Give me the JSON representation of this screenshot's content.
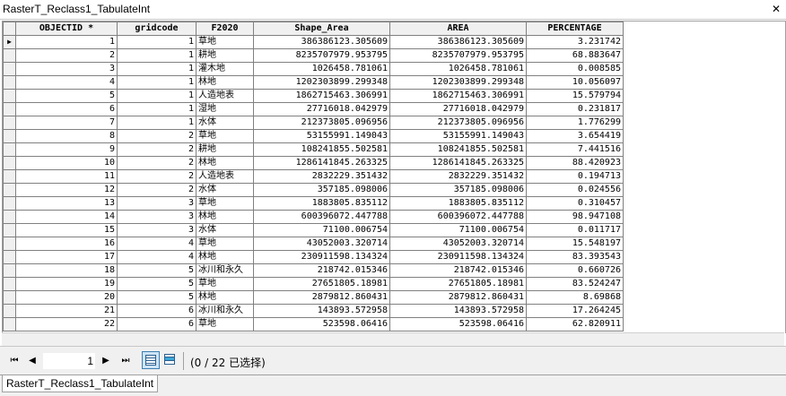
{
  "window": {
    "title": "RasterT_Reclass1_TabulateInt",
    "close_glyph": "✕"
  },
  "table": {
    "columns": [
      "OBJECTID *",
      "gridcode",
      "F2020",
      "Shape_Area",
      "AREA",
      "PERCENTAGE"
    ],
    "current_row_marker": "▶",
    "rows": [
      [
        "1",
        "1",
        "草地",
        "386386123.305609",
        "386386123.305609",
        "3.231742"
      ],
      [
        "2",
        "1",
        "耕地",
        "8235707979.953795",
        "8235707979.953795",
        "68.883647"
      ],
      [
        "3",
        "1",
        "灌木地",
        "1026458.781061",
        "1026458.781061",
        "0.008585"
      ],
      [
        "4",
        "1",
        "林地",
        "1202303899.299348",
        "1202303899.299348",
        "10.056097"
      ],
      [
        "5",
        "1",
        "人造地表",
        "1862715463.306991",
        "1862715463.306991",
        "15.579794"
      ],
      [
        "6",
        "1",
        "湿地",
        "27716018.042979",
        "27716018.042979",
        "0.231817"
      ],
      [
        "7",
        "1",
        "水体",
        "212373805.096956",
        "212373805.096956",
        "1.776299"
      ],
      [
        "8",
        "2",
        "草地",
        "53155991.149043",
        "53155991.149043",
        "3.654419"
      ],
      [
        "9",
        "2",
        "耕地",
        "108241855.502581",
        "108241855.502581",
        "7.441516"
      ],
      [
        "10",
        "2",
        "林地",
        "1286141845.263325",
        "1286141845.263325",
        "88.420923"
      ],
      [
        "11",
        "2",
        "人造地表",
        "2832229.351432",
        "2832229.351432",
        "0.194713"
      ],
      [
        "12",
        "2",
        "水体",
        "357185.098006",
        "357185.098006",
        "0.024556"
      ],
      [
        "13",
        "3",
        "草地",
        "1883805.835112",
        "1883805.835112",
        "0.310457"
      ],
      [
        "14",
        "3",
        "林地",
        "600396072.447788",
        "600396072.447788",
        "98.947108"
      ],
      [
        "15",
        "3",
        "水体",
        "71100.006754",
        "71100.006754",
        "0.011717"
      ],
      [
        "16",
        "4",
        "草地",
        "43052003.320714",
        "43052003.320714",
        "15.548197"
      ],
      [
        "17",
        "4",
        "林地",
        "230911598.134324",
        "230911598.134324",
        "83.393543"
      ],
      [
        "18",
        "5",
        "冰川和永久",
        "218742.015346",
        "218742.015346",
        "0.660726"
      ],
      [
        "19",
        "5",
        "草地",
        "27651805.18981",
        "27651805.18981",
        "83.524247"
      ],
      [
        "20",
        "5",
        "林地",
        "2879812.860431",
        "2879812.860431",
        "8.69868"
      ],
      [
        "21",
        "6",
        "冰川和永久",
        "143893.572958",
        "143893.572958",
        "17.264245"
      ],
      [
        "22",
        "6",
        "草地",
        "523598.06416",
        "523598.06416",
        "62.820911"
      ]
    ]
  },
  "navigator": {
    "first_glyph": "⏮",
    "prev_glyph": "◀",
    "page_value": "1",
    "next_glyph": "▶",
    "last_glyph": "⏭",
    "status": "(0 / 22 已选择)"
  },
  "tabs": [
    "RasterT_Reclass1_TabulateInt"
  ]
}
